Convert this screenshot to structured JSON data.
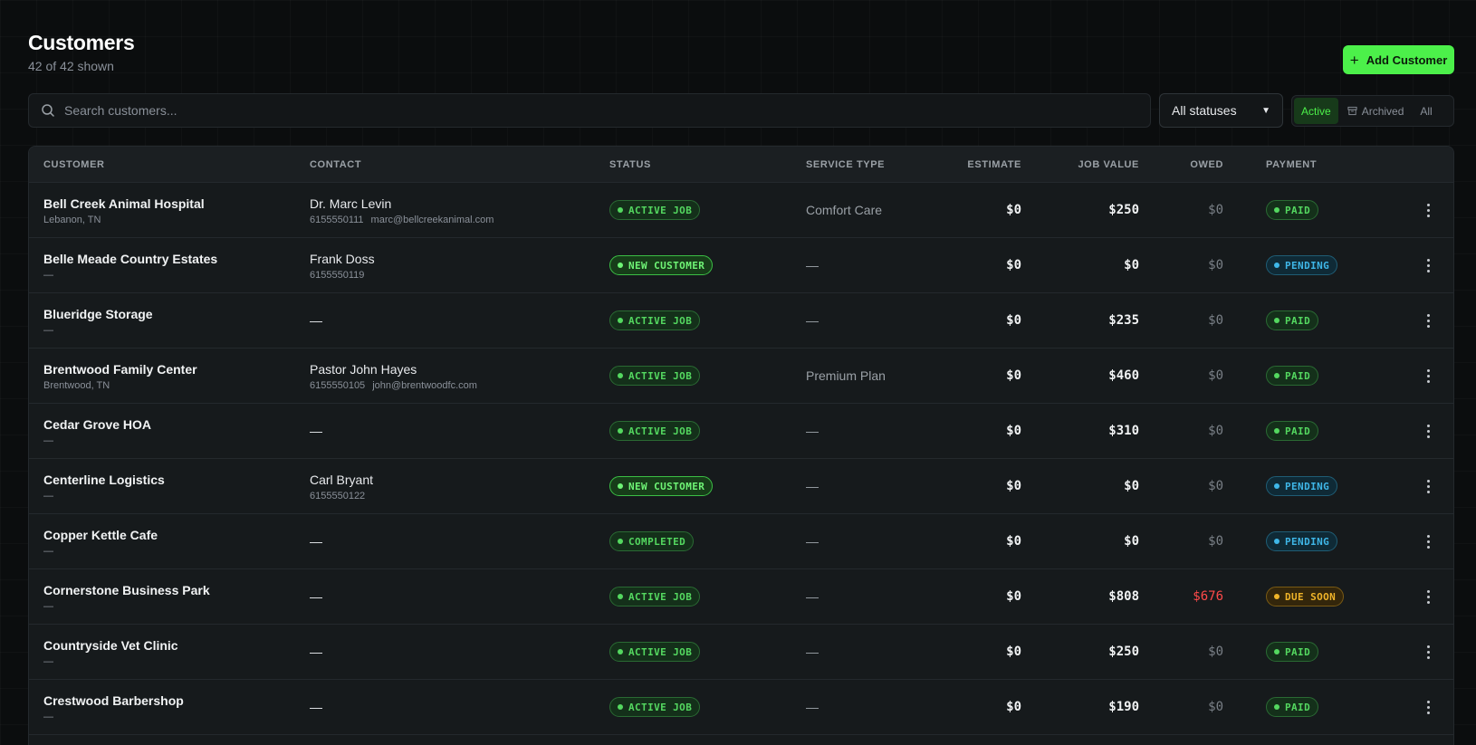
{
  "header": {
    "title": "Customers",
    "subtitle": "42 of 42 shown",
    "add_label": "Add Customer"
  },
  "search": {
    "placeholder": "Search customers..."
  },
  "status_filter": {
    "selected": "All statuses"
  },
  "view_toggle": {
    "active": "Active",
    "archived": "Archived",
    "all": "All"
  },
  "table": {
    "columns": {
      "customer": "CUSTOMER",
      "contact": "CONTACT",
      "status": "STATUS",
      "service": "SERVICE TYPE",
      "estimate": "ESTIMATE",
      "job_value": "JOB VALUE",
      "owed": "OWED",
      "payment": "PAYMENT"
    },
    "rows": [
      {
        "name": "Bell Creek Animal Hospital",
        "location": "Lebanon, TN",
        "contact_name": "Dr. Marc Levin",
        "phone": "6155550111",
        "email": "marc@bellcreekanimal.com",
        "status": "ACTIVE JOB",
        "service": "Comfort Care",
        "estimate": "$0",
        "job_value": "$250",
        "owed": "$0",
        "payment": "PAID"
      },
      {
        "name": "Belle Meade Country Estates",
        "location": "—",
        "contact_name": "Frank Doss",
        "phone": "6155550119",
        "email": "",
        "status": "NEW CUSTOMER",
        "service": "—",
        "estimate": "$0",
        "job_value": "$0",
        "owed": "$0",
        "payment": "PENDING"
      },
      {
        "name": "Blueridge Storage",
        "location": "—",
        "contact_name": "—",
        "phone": "",
        "email": "",
        "status": "ACTIVE JOB",
        "service": "—",
        "estimate": "$0",
        "job_value": "$235",
        "owed": "$0",
        "payment": "PAID"
      },
      {
        "name": "Brentwood Family Center",
        "location": "Brentwood, TN",
        "contact_name": "Pastor John Hayes",
        "phone": "6155550105",
        "email": "john@brentwoodfc.com",
        "status": "ACTIVE JOB",
        "service": "Premium Plan",
        "estimate": "$0",
        "job_value": "$460",
        "owed": "$0",
        "payment": "PAID"
      },
      {
        "name": "Cedar Grove HOA",
        "location": "—",
        "contact_name": "—",
        "phone": "",
        "email": "",
        "status": "ACTIVE JOB",
        "service": "—",
        "estimate": "$0",
        "job_value": "$310",
        "owed": "$0",
        "payment": "PAID"
      },
      {
        "name": "Centerline Logistics",
        "location": "—",
        "contact_name": "Carl Bryant",
        "phone": "6155550122",
        "email": "",
        "status": "NEW CUSTOMER",
        "service": "—",
        "estimate": "$0",
        "job_value": "$0",
        "owed": "$0",
        "payment": "PENDING"
      },
      {
        "name": "Copper Kettle Cafe",
        "location": "—",
        "contact_name": "—",
        "phone": "",
        "email": "",
        "status": "COMPLETED",
        "service": "—",
        "estimate": "$0",
        "job_value": "$0",
        "owed": "$0",
        "payment": "PENDING"
      },
      {
        "name": "Cornerstone Business Park",
        "location": "—",
        "contact_name": "—",
        "phone": "",
        "email": "",
        "status": "ACTIVE JOB",
        "service": "—",
        "estimate": "$0",
        "job_value": "$808",
        "owed": "$676",
        "payment": "DUE SOON"
      },
      {
        "name": "Countryside Vet Clinic",
        "location": "—",
        "contact_name": "—",
        "phone": "",
        "email": "",
        "status": "ACTIVE JOB",
        "service": "—",
        "estimate": "$0",
        "job_value": "$250",
        "owed": "$0",
        "payment": "PAID"
      },
      {
        "name": "Crestwood Barbershop",
        "location": "—",
        "contact_name": "—",
        "phone": "",
        "email": "",
        "status": "ACTIVE JOB",
        "service": "—",
        "estimate": "$0",
        "job_value": "$190",
        "owed": "$0",
        "payment": "PAID"
      }
    ]
  },
  "colors": {
    "accent": "#4cf04a",
    "background": "#0b0d0e",
    "active": "#54d860",
    "pending": "#3fb7e8",
    "due_soon": "#f0b429",
    "owed_alert": "#ff4a4a"
  },
  "icons": {
    "search": "search-icon",
    "add": "plus-icon",
    "archive": "archive-icon",
    "row_menu": "more-vertical-icon",
    "select": "chevron-down-icon"
  }
}
